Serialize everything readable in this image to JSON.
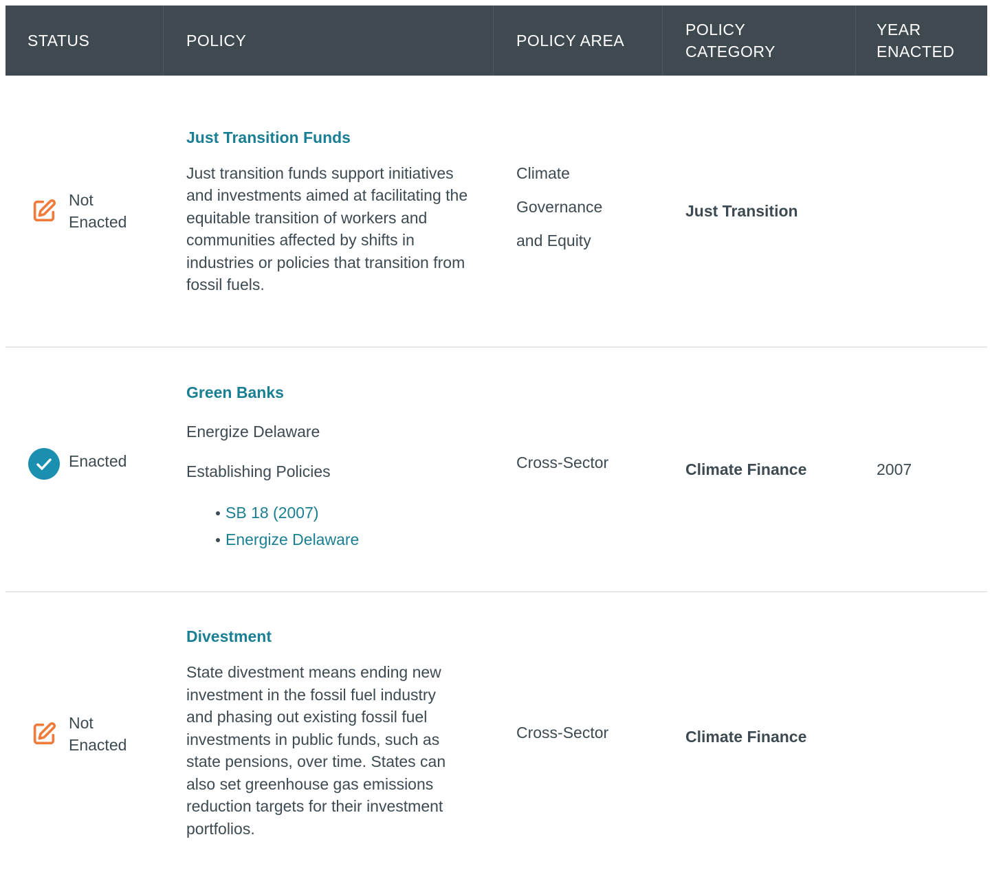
{
  "header": {
    "status": "STATUS",
    "policy": "POLICY",
    "policy_area": "POLICY AREA",
    "policy_category_line1": "POLICY",
    "policy_category_line2": "CATEGORY",
    "year_line1": "YEAR",
    "year_line2": "ENACTED"
  },
  "colors": {
    "header_bg": "#3f4a50",
    "link": "#1a7f93",
    "not_enacted_icon": "#f07b3a",
    "enacted_icon": "#1a8fb0"
  },
  "rows": [
    {
      "status_icon": "edit-icon",
      "status_line1": "Not",
      "status_line2": "Enacted",
      "title": "Just Transition Funds",
      "description": "Just transition funds support initiatives and investments aimed at facilitating the equitable transition of workers and communities affected by shifts in industries or policies that transition from fossil fuels.",
      "area_line1": "Climate",
      "area_line2": "Governance",
      "area_line3": "and Equity",
      "category": "Just Transition",
      "year": ""
    },
    {
      "status_icon": "check-circle-icon",
      "status_line1": "Enacted",
      "title": "Green Banks",
      "subtitle": "Energize Delaware",
      "establishing_label": "Establishing Policies",
      "links": [
        "SB 18 (2007)",
        "Energize Delaware"
      ],
      "area_line1": "Cross-Sector",
      "category": "Climate Finance",
      "year": "2007"
    },
    {
      "status_icon": "edit-icon",
      "status_line1": "Not",
      "status_line2": "Enacted",
      "title": "Divestment",
      "description": "State divestment means ending new investment in the fossil fuel industry and phasing out existing fossil fuel investments in public funds, such as state pensions, over time. States can also set greenhouse gas emissions reduction targets for their investment portfolios.",
      "area_line1": "Cross-Sector",
      "category": "Climate Finance",
      "year": ""
    }
  ]
}
